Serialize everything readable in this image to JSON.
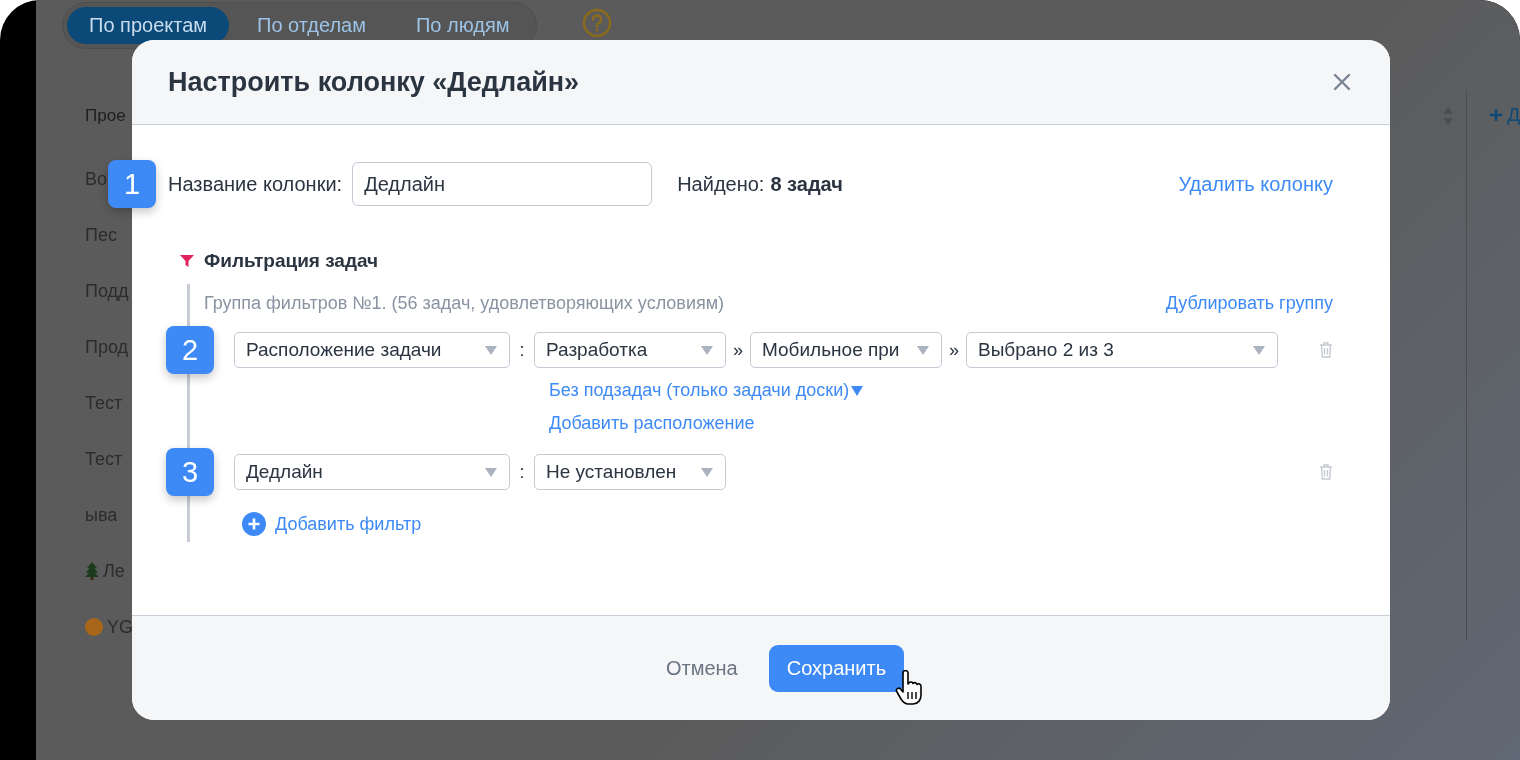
{
  "background": {
    "tabs": [
      {
        "label": "По проектам",
        "selected": true
      },
      {
        "label": "По отделам",
        "selected": false
      },
      {
        "label": "По людям",
        "selected": false
      }
    ],
    "sidebar_header": "Прое",
    "sidebar_items": [
      {
        "label": "Во",
        "kind": "text"
      },
      {
        "label": "Пес",
        "kind": "text"
      },
      {
        "label": "Подд",
        "kind": "text"
      },
      {
        "label": "Прод",
        "kind": "text"
      },
      {
        "label": "Тест",
        "kind": "text"
      },
      {
        "label": "Тест",
        "kind": "text"
      },
      {
        "label": "ыва",
        "kind": "text"
      },
      {
        "label": "Ле",
        "kind": "tree"
      },
      {
        "label": "YG",
        "kind": "dot",
        "color": "#a8661a"
      }
    ],
    "add_column": "Д"
  },
  "modal": {
    "title": "Настроить колонку «Дедлайн»",
    "name_step": "1",
    "name_label": "Название колонки:",
    "name_value": "Дедлайн",
    "found_label": "Найдено:",
    "found_count": "8 задач",
    "delete_link": "Удалить колонку",
    "filter_title": "Фильтрация задач",
    "group_caption": "Группа фильтров №1. (56 задач, удовлетворяющих условиям)",
    "duplicate_link": "Дублировать группу",
    "filters": [
      {
        "step": "2",
        "parts": [
          {
            "kind": "select",
            "text": "Расположение задачи"
          },
          {
            "kind": "separator",
            "text": ":"
          },
          {
            "kind": "select",
            "text": "Разработка"
          },
          {
            "kind": "separator",
            "text": "»"
          },
          {
            "kind": "select",
            "text": "Мобильное при"
          },
          {
            "kind": "separator",
            "text": "»"
          },
          {
            "kind": "select",
            "text": "Выбрано 2 из 3"
          }
        ],
        "links": [
          {
            "text": "Без подзадач (только задачи доски)",
            "dropdown": true
          },
          {
            "text": "Добавить расположение",
            "dropdown": false
          }
        ]
      },
      {
        "step": "3",
        "parts": [
          {
            "kind": "select",
            "text": "Дедлайн"
          },
          {
            "kind": "separator",
            "text": ":"
          },
          {
            "kind": "select",
            "text": "Не установлен"
          }
        ]
      }
    ],
    "add_filter": "Добавить фильтр",
    "cancel": "Отмена",
    "save": "Сохранить"
  }
}
